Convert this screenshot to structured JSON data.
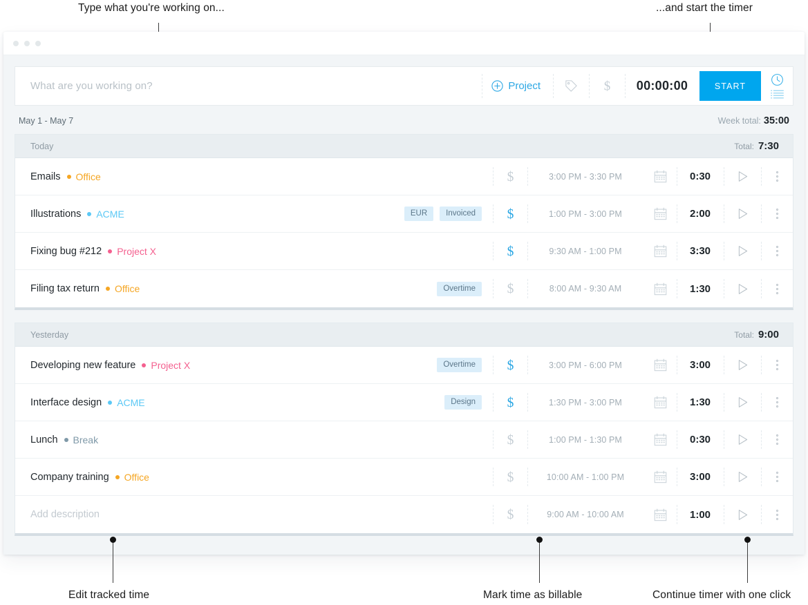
{
  "annotations": {
    "top_left": "Type what you're working on...",
    "top_right": "...and start the timer",
    "bottom_left": "Edit tracked time",
    "bottom_mid": "Mark time as billable",
    "bottom_right": "Continue timer with one click"
  },
  "colors": {
    "accent": "#00a6ee",
    "link": "#2ca7e4",
    "office": "#f5a623",
    "acme": "#5bc8f5",
    "projectx": "#f4608f",
    "break": "#7f99a8",
    "tag_bg": "#dbeefa",
    "tag_text": "#5b7689"
  },
  "timer": {
    "placeholder": "What are you working on?",
    "project_label": "Project",
    "project_icon": "plus-circle-icon",
    "tag_icon": "tag-icon",
    "billable_icon": "dollar-icon",
    "elapsed": "00:00:00",
    "start_label": "START",
    "mode_timer_icon": "clock-icon",
    "mode_manual_icon": "list-icon"
  },
  "week": {
    "range": "May 1 - May 7",
    "total_label": "Week total:",
    "total_value": "35:00"
  },
  "days": [
    {
      "title": "Today",
      "total_label": "Total:",
      "total_value": "7:30",
      "entries": [
        {
          "description": "Emails",
          "placeholder": false,
          "project": "Office",
          "project_color": "#f5a623",
          "tags": [],
          "billable": false,
          "range": "3:00 PM - 3:30 PM",
          "duration": "0:30"
        },
        {
          "description": "Illustrations",
          "placeholder": false,
          "project": "ACME",
          "project_color": "#5bc8f5",
          "tags": [
            "EUR",
            "Invoiced"
          ],
          "billable": true,
          "range": "1:00 PM - 3:00 PM",
          "duration": "2:00"
        },
        {
          "description": "Fixing bug #212",
          "placeholder": false,
          "project": "Project X",
          "project_color": "#f4608f",
          "tags": [],
          "billable": true,
          "range": "9:30 AM - 1:00 PM",
          "duration": "3:30"
        },
        {
          "description": "Filing tax return",
          "placeholder": false,
          "project": "Office",
          "project_color": "#f5a623",
          "tags": [
            "Overtime"
          ],
          "billable": false,
          "range": "8:00 AM - 9:30 AM",
          "duration": "1:30"
        }
      ]
    },
    {
      "title": "Yesterday",
      "total_label": "Total:",
      "total_value": "9:00",
      "entries": [
        {
          "description": "Developing new feature",
          "placeholder": false,
          "project": "Project X",
          "project_color": "#f4608f",
          "tags": [
            "Overtime"
          ],
          "billable": true,
          "range": "3:00 PM - 6:00 PM",
          "duration": "3:00"
        },
        {
          "description": "Interface design",
          "placeholder": false,
          "project": "ACME",
          "project_color": "#5bc8f5",
          "tags": [
            "Design"
          ],
          "billable": true,
          "range": "1:30 PM - 3:00 PM",
          "duration": "1:30"
        },
        {
          "description": "Lunch",
          "placeholder": false,
          "project": "Break",
          "project_color": "#7f99a8",
          "tags": [],
          "billable": false,
          "range": "1:00 PM - 1:30 PM",
          "duration": "0:30"
        },
        {
          "description": "Company training",
          "placeholder": false,
          "project": "Office",
          "project_color": "#f5a623",
          "tags": [],
          "billable": false,
          "range": "10:00 AM - 1:00 PM",
          "duration": "3:00"
        },
        {
          "description": "Add description",
          "placeholder": true,
          "project": "",
          "project_color": "",
          "tags": [],
          "billable": false,
          "range": "9:00 AM - 10:00 AM",
          "duration": "1:00"
        }
      ]
    }
  ],
  "icons": {
    "billable": "dollar-icon",
    "calendar": "calendar-icon",
    "play": "play-icon",
    "menu": "kebab-menu-icon"
  }
}
